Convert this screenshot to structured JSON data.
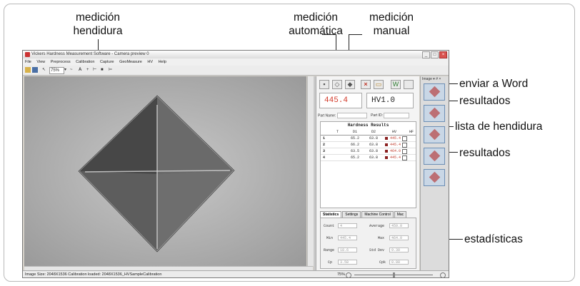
{
  "callouts": {
    "medicion_hendidura": [
      "medición",
      "hendidura"
    ],
    "medicion_automatica": [
      "medición",
      "automática"
    ],
    "medicion_manual": [
      "medición",
      "manual"
    ],
    "enviar_word": "enviar a Word",
    "resultados_top": "resultados",
    "lista_hendidura": "lista de hendidura",
    "resultados_table": "resultados",
    "estadisticas": "estadísticas"
  },
  "app": {
    "title": "Vickers Hardness Measurement Software - Camera preview 0",
    "menu": [
      "File",
      "View",
      "Preprocess",
      "Calibration",
      "Capture",
      "GeoMeasure",
      "HV",
      "Help"
    ],
    "toolbar_zoom": "75%",
    "status_text": "Image Size: 2048X1536   Calibration loaded: 2048X1536_HVSampleCalibration",
    "status_zoom": "75%"
  },
  "results": {
    "hv_value": "445.4",
    "hv_unit": "HV1.0",
    "part_name_label": "Part Name:",
    "part_id_label": "Part ID:",
    "table_title": "Hardness Results",
    "columns": [
      "T",
      "D1",
      "D2",
      "HV",
      "HF"
    ],
    "rows": [
      {
        "n": "1",
        "d1": "65.2",
        "d2": "63.8",
        "hv": "445.4"
      },
      {
        "n": "2",
        "d1": "66.2",
        "d2": "63.8",
        "hv": "445.4"
      },
      {
        "n": "3",
        "d1": "63.5",
        "d2": "63.8",
        "hv": "464.0"
      },
      {
        "n": "4",
        "d1": "65.2",
        "d2": "63.8",
        "hv": "445.4"
      }
    ]
  },
  "tabs": [
    "Statistics",
    "Settings",
    "Machine Control",
    "Mac"
  ],
  "stats": {
    "count_label": "Count",
    "count": "4",
    "average_label": "Average",
    "average": "450.0",
    "min_label": "Min",
    "min": "445.4",
    "max_label": "Max",
    "max": "464.0",
    "range_label": "Range",
    "range": "18.6",
    "std_label": "Std Dev",
    "std": "9.30",
    "cp_label": "Cp",
    "cp": "3.58",
    "cpk_label": "Cpk",
    "cpk": "0.00"
  },
  "gallery": {
    "title": "Image"
  }
}
